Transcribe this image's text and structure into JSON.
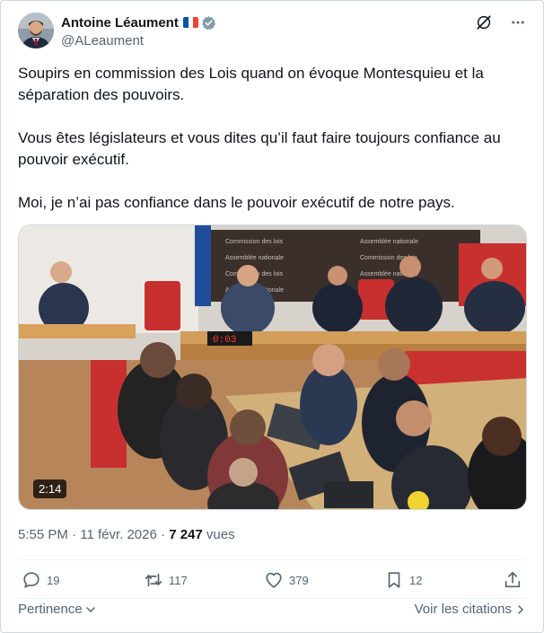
{
  "author": {
    "display_name": "Antoine Léaument",
    "handle": "@ALeaument",
    "avatar_icon": "profile-photo",
    "flag_icon": "france-flag-icon",
    "verified_icon": "verified-badge-icon",
    "verified_color": "#829aab"
  },
  "header_icons": [
    "grok-icon",
    "more-icon"
  ],
  "tweet": {
    "paragraphs": [
      "Soupirs en commission des Lois quand on évoque Montesquieu et la séparation des pouvoirs.",
      "Vous êtes législateurs et vous dites qu’il faut faire toujours confiance au pouvoir exécutif.",
      "Moi, je n’ai pas confiance dans le pouvoir exécutif de notre pays."
    ]
  },
  "media": {
    "type": "video",
    "duration": "2:14",
    "timer_display": "0:03"
  },
  "meta": {
    "time": "5:55 PM",
    "separator": "·",
    "date": "11 févr. 2026",
    "views_count": "7 247",
    "views_label": "vues"
  },
  "actions": {
    "replies": "19",
    "reposts": "117",
    "likes": "379",
    "bookmarks": "12"
  },
  "footer": {
    "relevance_label": "Pertinence",
    "quotes_label": "Voir les citations"
  },
  "colors": {
    "text_primary": "#0f1419",
    "text_secondary": "#536471",
    "border": "#cfd9de"
  }
}
